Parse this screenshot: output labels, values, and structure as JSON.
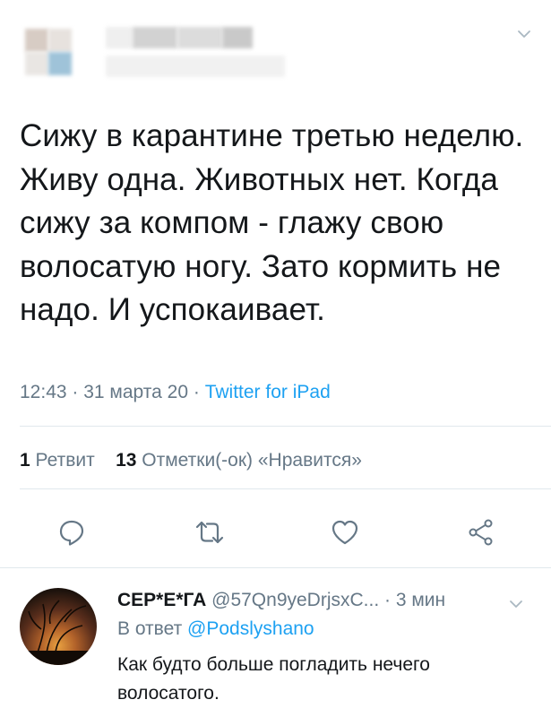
{
  "tweet": {
    "text": "Сижу в карантине третью неделю. Живу одна. Животных нет. Когда сижу за компом - глажу свою волосатую ногу. Зато кормить не надо. И успокаивает.",
    "time": "12:43",
    "date": "31 марта 20",
    "sep": " · ",
    "source": "Twitter for iPad",
    "retweets_count": "1",
    "retweets_label": "Ретвит",
    "likes_count": "13",
    "likes_label": "Отметки(-ок) «Нравится»"
  },
  "actions": [
    {
      "icon": "reply-icon"
    },
    {
      "icon": "retweet-icon"
    },
    {
      "icon": "like-icon"
    },
    {
      "icon": "share-icon"
    }
  ],
  "reply": {
    "name": "СЕР*Е*ГА",
    "handle": "@57Qn9yeDrjsxC...",
    "time": "3 мин",
    "reply_to_label": "В ответ",
    "reply_to_mention": "@Podslyshano",
    "text": "Как будто больше погладить нечего волосатого."
  },
  "colors": {
    "text": "#14171a",
    "secondary": "#657786",
    "accent": "#1da1f2",
    "divider": "#e1e8ed"
  }
}
